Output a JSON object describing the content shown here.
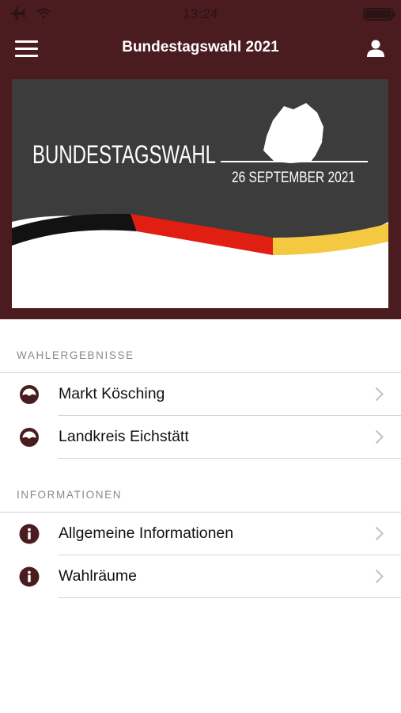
{
  "status": {
    "time": "13:24"
  },
  "nav": {
    "title": "Bundestagswahl 2021"
  },
  "banner": {
    "headline": "BUNDESTAGSWAHL",
    "date": "26 SEPTEMBER 2021"
  },
  "sections": [
    {
      "header": "WAHLERGEBNISSE",
      "items": [
        {
          "label": "Markt Kösching",
          "icon": "result-gauge-icon"
        },
        {
          "label": "Landkreis Eichstätt",
          "icon": "result-gauge-icon"
        }
      ]
    },
    {
      "header": "INFORMATIONEN",
      "items": [
        {
          "label": "Allgemeine Informationen",
          "icon": "info-icon"
        },
        {
          "label": "Wahlräume",
          "icon": "info-icon"
        }
      ]
    }
  ],
  "colors": {
    "brand": "#4a1c20",
    "accent_icon": "#4a1c20",
    "separator": "#d4d4d6"
  }
}
